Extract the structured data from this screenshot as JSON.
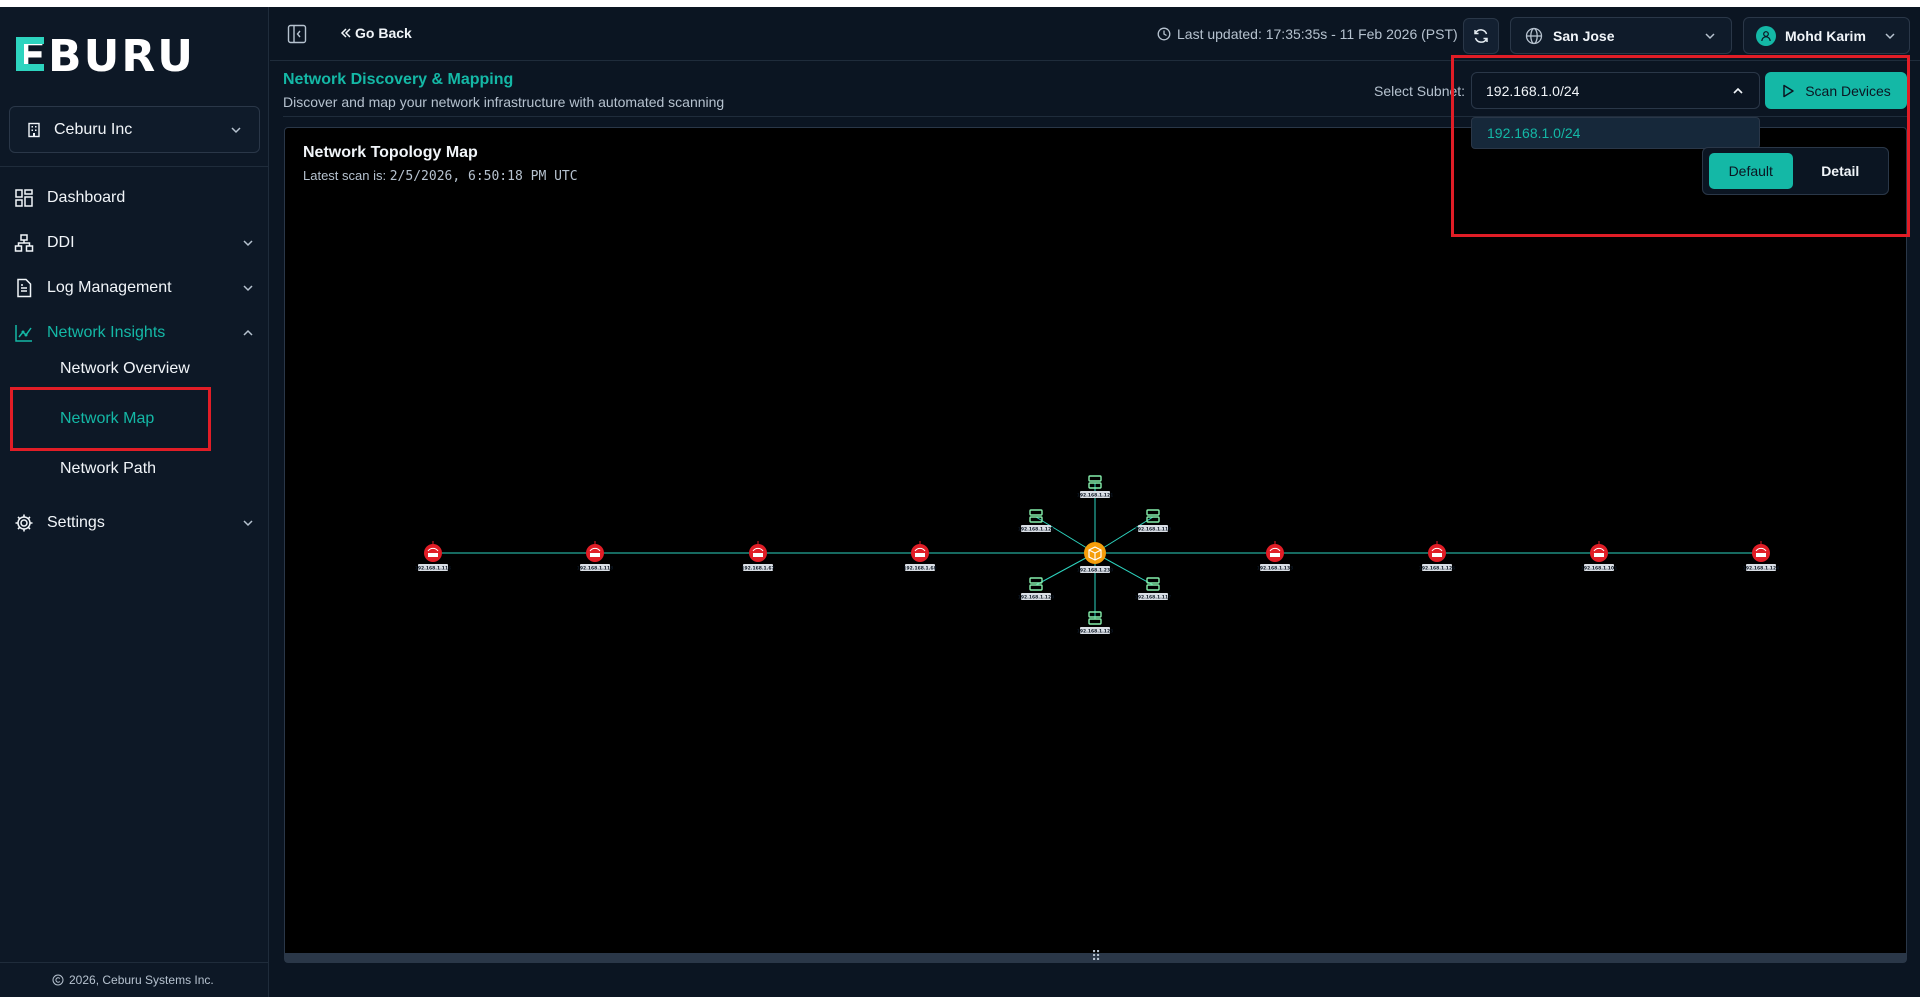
{
  "brand": {
    "logo_text": "CEBURU"
  },
  "sidebar": {
    "org": "Ceburu Inc",
    "items": [
      {
        "label": "Dashboard"
      },
      {
        "label": "DDI"
      },
      {
        "label": "Log Management"
      },
      {
        "label": "Network Insights"
      },
      {
        "label": "Settings"
      }
    ],
    "subitems": [
      {
        "label": "Network Overview"
      },
      {
        "label": "Network Map"
      },
      {
        "label": "Network Path"
      }
    ],
    "footer": "2026, Ceburu Systems Inc."
  },
  "topbar": {
    "go_back": "Go Back",
    "last_updated": "Last updated: 17:35:35s - 11 Feb 2026 (PST)",
    "location": "San Jose",
    "user": "Mohd Karim"
  },
  "page": {
    "title": "Network Discovery & Mapping",
    "subtitle": "Discover and map your network infrastructure with automated scanning",
    "subnet_label": "Select Subnet:",
    "subnet_value": "192.168.1.0/24",
    "subnet_options": [
      "192.168.1.0/24"
    ],
    "scan_button": "Scan Devices",
    "views": [
      "Default",
      "Detail"
    ]
  },
  "topology": {
    "title": "Network Topology Map",
    "scan_label": "Latest scan is:",
    "scan_time": "2/5/2026, 6:50:18 PM UTC",
    "center_node": "192.168.1.230",
    "routers_left": [
      "192.168.1.116",
      "192.168.1.118",
      "192.168.1.67",
      "192.168.1.68"
    ],
    "routers_right": [
      "192.168.1.133",
      "192.168.1.126",
      "192.168.1.101",
      "192.168.1.124"
    ],
    "servers": [
      "192.168.1.121",
      "192.168.1.121",
      "192.168.1.119",
      "192.168.1.120",
      "192.168.1.117",
      "192.168.1.123"
    ],
    "colors": {
      "router": "#e11d26",
      "server": "#86efac",
      "hub": "#f59e0b",
      "link": "#2dd4bf"
    }
  }
}
